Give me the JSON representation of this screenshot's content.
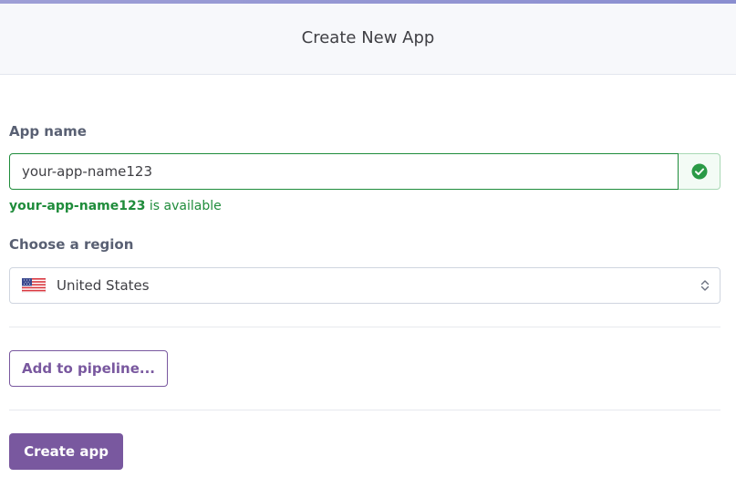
{
  "header": {
    "title": "Create New App"
  },
  "app_name": {
    "label": "App name",
    "value": "your-app-name123",
    "status_icon": "check-circle-icon",
    "availability": {
      "name": "your-app-name123",
      "suffix": " is available"
    }
  },
  "region": {
    "label": "Choose a region",
    "selected": "United States",
    "flag_icon": "us-flag-icon",
    "chevron_icon": "chevron-updown-icon"
  },
  "actions": {
    "pipeline_label": "Add to pipeline...",
    "create_label": "Create app"
  },
  "colors": {
    "accent": "#79589f",
    "success": "#1f8c3b",
    "topbar": "#9e9fd6"
  }
}
